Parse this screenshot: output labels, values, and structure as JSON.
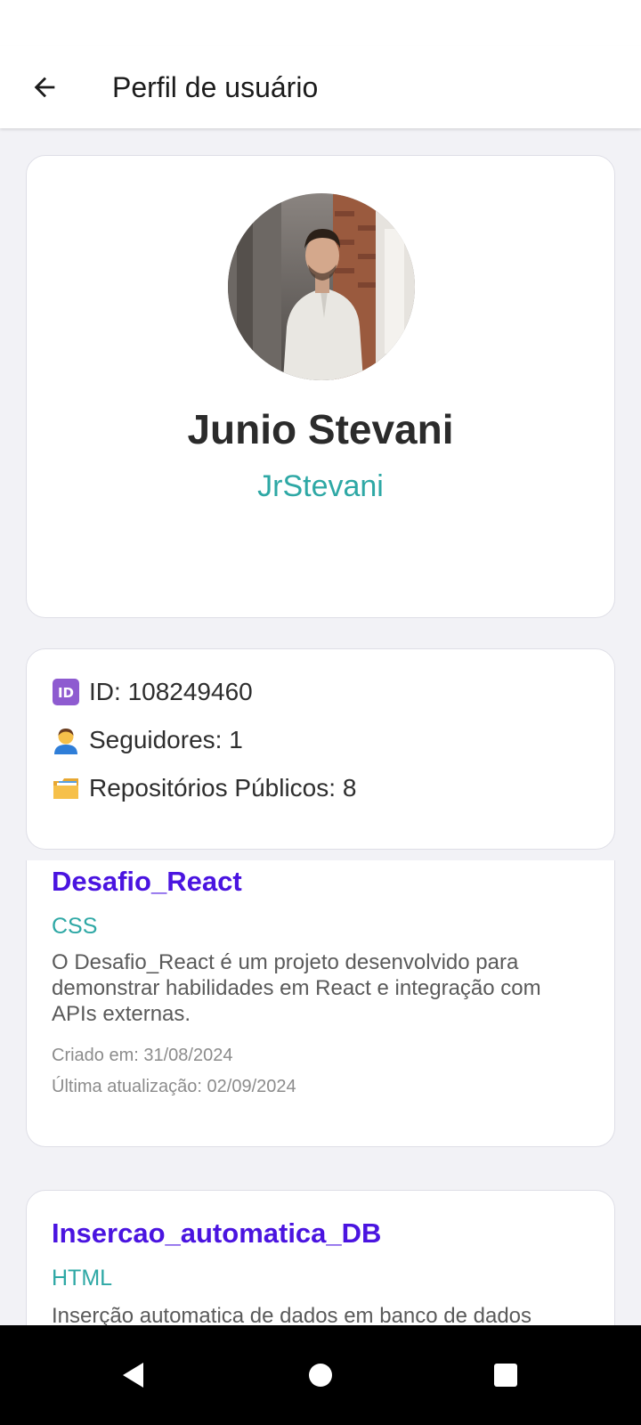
{
  "app_bar": {
    "title": "Perfil de usuário",
    "back_icon": "arrow-left-icon"
  },
  "profile": {
    "name": "Junio Stevani",
    "username": "JrStevani",
    "avatar_icon": "user-photo"
  },
  "stats": {
    "id_label": "ID:",
    "id_value": "108249460",
    "followers_label": "Seguidores:",
    "followers_value": "1",
    "repos_label": "Repositórios Públicos:",
    "repos_value": "8"
  },
  "repos": [
    {
      "name": "Desafio_React",
      "language": "CSS",
      "description": "O Desafio_React é um projeto desenvolvido para demonstrar habilidades em React e integração com APIs externas.",
      "created": "Criado em: 31/08/2024",
      "updated": "Última atualização: 02/09/2024"
    },
    {
      "name": "Insercao_automatica_DB",
      "language": "HTML",
      "description": "Inserção automatica de dados em banco de dados"
    }
  ],
  "colors": {
    "accent_teal": "#2ea8a5",
    "repo_link": "#4a14e0",
    "background": "#f2f2f6"
  }
}
